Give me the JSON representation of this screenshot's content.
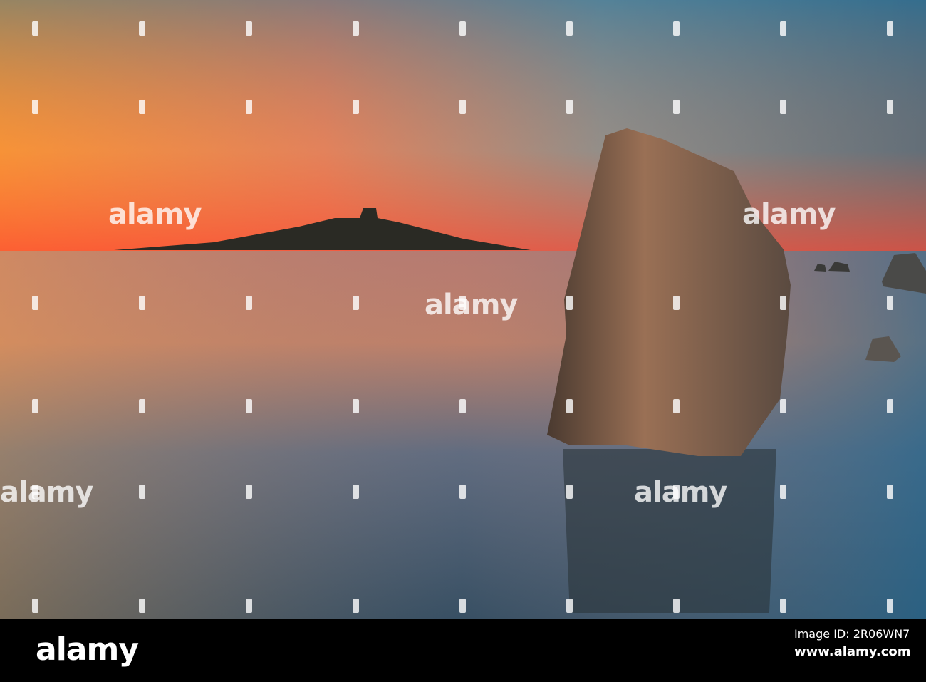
{
  "watermark": {
    "text": "alamy"
  },
  "footer": {
    "logo": "alamy",
    "image_id": "Image ID: 2R06WN7",
    "website": "www.alamy.com"
  },
  "colors": {
    "sky_warm": "#f07a2a",
    "sky_cool": "#3f7fa0",
    "sea": "#3a5a70",
    "bar": "#000000"
  }
}
